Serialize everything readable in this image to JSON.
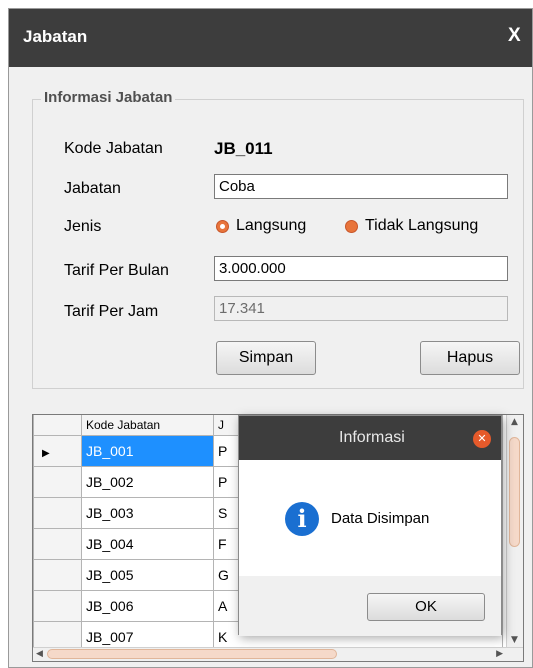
{
  "window": {
    "title": "Jabatan",
    "close_label": "X"
  },
  "form": {
    "group_title": "Informasi Jabatan",
    "kode_label": "Kode Jabatan",
    "kode_value": "JB_011",
    "jabatan_label": "Jabatan",
    "jabatan_value": "Coba",
    "jenis_label": "Jenis",
    "jenis_options": [
      "Langsung",
      "Tidak Langsung"
    ],
    "jenis_selected": "Langsung",
    "tarif_bulan_label": "Tarif Per Bulan",
    "tarif_bulan_value": "3.000.000",
    "tarif_jam_label": "Tarif Per Jam",
    "tarif_jam_value": "17.341",
    "simpan_label": "Simpan",
    "hapus_label": "Hapus"
  },
  "grid": {
    "headers": [
      "Kode Jabatan",
      "J"
    ],
    "rows": [
      {
        "code": "JB_001",
        "name": "P",
        "selected": true
      },
      {
        "code": "JB_002",
        "name": "P"
      },
      {
        "code": "JB_003",
        "name": "S"
      },
      {
        "code": "JB_004",
        "name": "F"
      },
      {
        "code": "JB_005",
        "name": "G"
      },
      {
        "code": "JB_006",
        "name": "A"
      },
      {
        "code": "JB_007",
        "name": "K"
      }
    ]
  },
  "dialog": {
    "title": "Informasi",
    "message": "Data Disimpan",
    "ok_label": "OK",
    "icon": "info-icon"
  },
  "colors": {
    "titlebar": "#3d3d3d",
    "radio": "#e8743b",
    "selection": "#1e90ff",
    "info": "#1a6fd1"
  }
}
